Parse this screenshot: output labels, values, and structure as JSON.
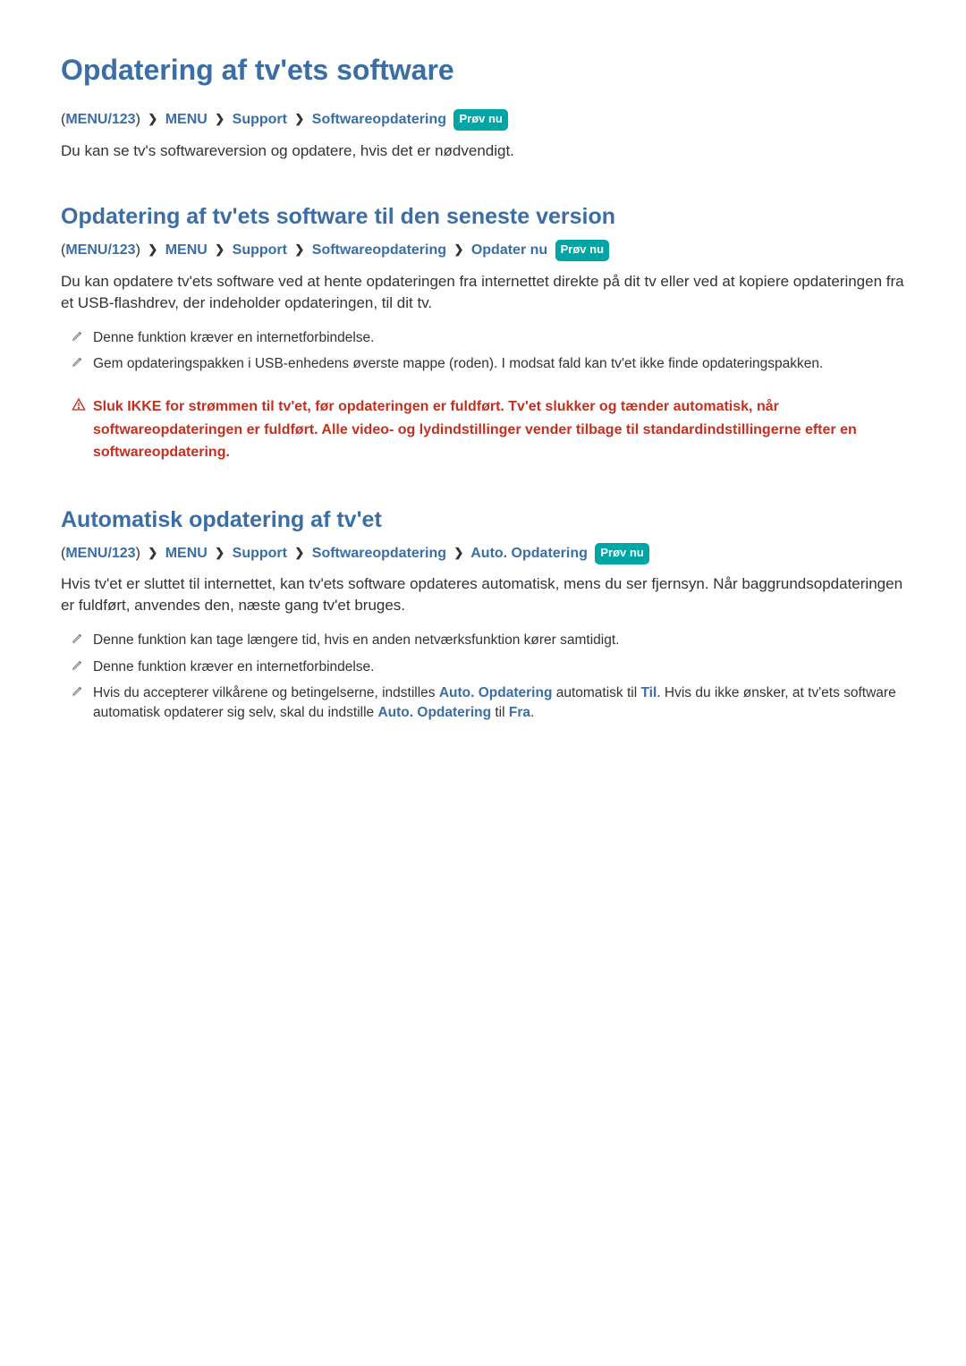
{
  "page_title": "Opdatering af tv'ets software",
  "try_now_label": "Prøv nu",
  "crumb_open": "(",
  "crumb_close": ")",
  "crumb_menu123": "MENU/123",
  "crumb_menu": "MENU",
  "crumb_support": "Support",
  "crumb_swupdate": "Softwareopdatering",
  "crumb_update_now": "Opdater nu",
  "crumb_auto_update": "Auto. Opdatering",
  "section1": {
    "body": "Du kan se tv's softwareversion og opdatere, hvis det er nødvendigt."
  },
  "section2": {
    "title": "Opdatering af tv'ets software til den seneste version",
    "body": "Du kan opdatere tv'ets software ved at hente opdateringen fra internettet direkte på dit tv eller ved at kopiere opdateringen fra et USB-flashdrev, der indeholder opdateringen, til dit tv.",
    "note1": "Denne funktion kræver en internetforbindelse.",
    "note2": "Gem opdateringspakken i USB-enhedens øverste mappe (roden). I modsat fald kan tv'et ikke finde opdateringspakken.",
    "warning": "Sluk IKKE for strømmen til tv'et, før opdateringen er fuldført. Tv'et slukker og tænder automatisk, når softwareopdateringen er fuldført. Alle video- og lydindstillinger vender tilbage til standardindstillingerne efter en softwareopdatering."
  },
  "section3": {
    "title": "Automatisk opdatering af tv'et",
    "body": "Hvis tv'et er sluttet til internettet, kan tv'ets software opdateres automatisk, mens du ser fjernsyn. Når baggrundsopdateringen er fuldført, anvendes den, næste gang tv'et bruges.",
    "note1": "Denne funktion kan tage længere tid, hvis en anden netværksfunktion kører samtidigt.",
    "note2": "Denne funktion kræver en internetforbindelse.",
    "note3_a": "Hvis du accepterer vilkårene og betingelserne, indstilles ",
    "note3_b": "Auto. Opdatering",
    "note3_c": " automatisk til ",
    "note3_d": "Til",
    "note3_e": ". Hvis du ikke ønsker, at tv'ets software automatisk opdaterer sig selv, skal du indstille ",
    "note3_f": "Auto. Opdatering",
    "note3_g": " til ",
    "note3_h": "Fra",
    "note3_i": "."
  }
}
